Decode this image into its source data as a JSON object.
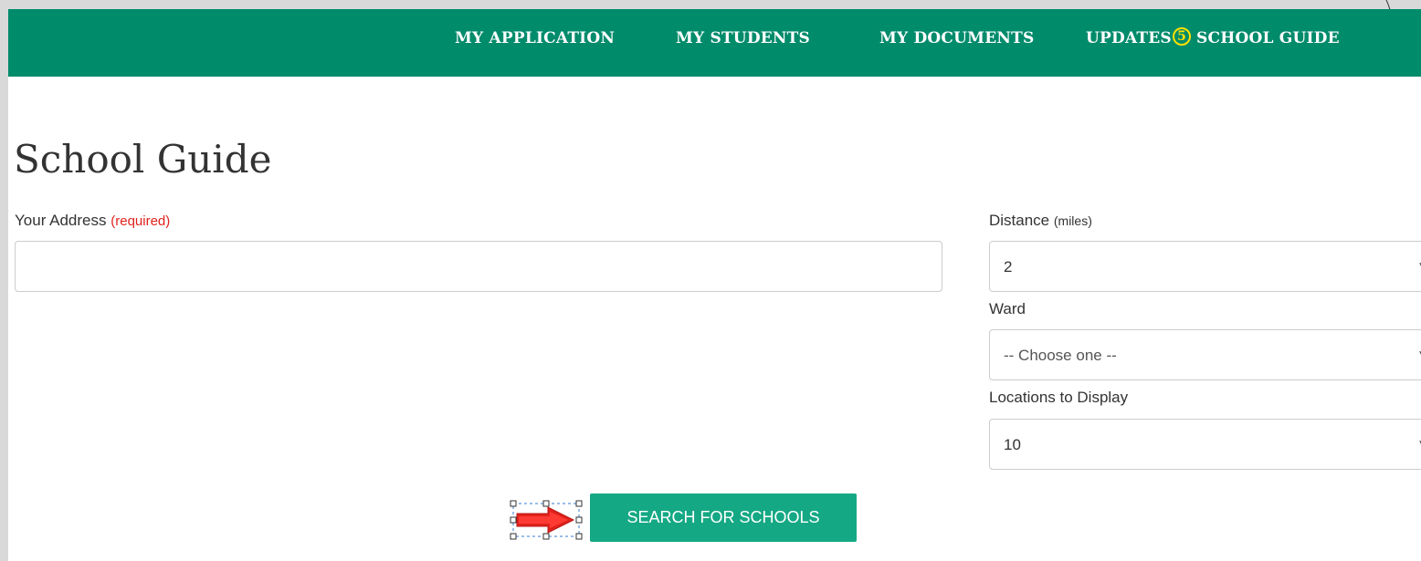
{
  "nav": {
    "items": [
      {
        "label": "MY APPLICATION"
      },
      {
        "label": "MY STUDENTS"
      },
      {
        "label": "MY DOCUMENTS"
      },
      {
        "label": "UPDATES"
      },
      {
        "label": "SCHOOL GUIDE"
      }
    ],
    "updates_badge": "5"
  },
  "page": {
    "title": "School Guide"
  },
  "form": {
    "address": {
      "label": "Your Address",
      "required_note": "(required)",
      "value": "",
      "placeholder": ""
    },
    "distance": {
      "label": "Distance",
      "unit_note": "(miles)",
      "selected": "2"
    },
    "ward": {
      "label": "Ward",
      "selected": "-- Choose one --"
    },
    "locations": {
      "label": "Locations to Display",
      "selected": "10"
    },
    "search_button": "SEARCH FOR SCHOOLS"
  },
  "colors": {
    "navbar": "#008b6b",
    "badge": "#ffe100",
    "button": "#14a884",
    "required": "#e0221c",
    "annotation_arrow": "#e0221c"
  },
  "icons": {
    "dropdown": "triangle-down",
    "annotation": "right-arrow"
  }
}
